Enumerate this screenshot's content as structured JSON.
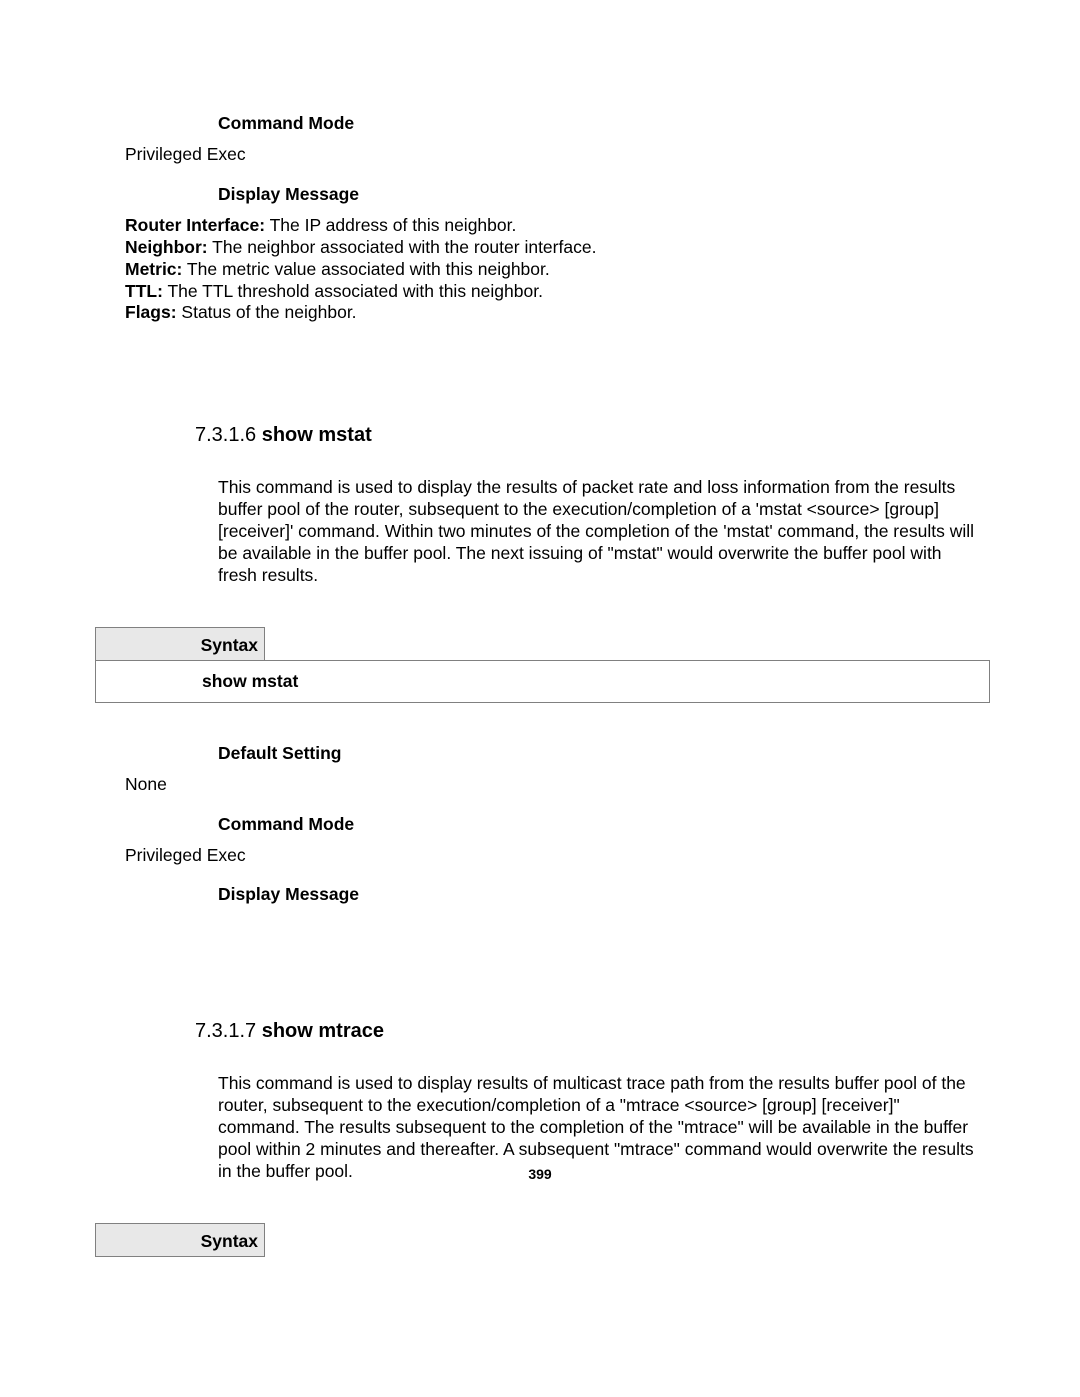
{
  "top": {
    "cmd_mode_label": "Command Mode",
    "cmd_mode_value": "Privileged Exec",
    "display_label": "Display Message",
    "fields": [
      {
        "name": "Router Interface:",
        "desc": " The IP address of this neighbor."
      },
      {
        "name": "Neighbor:",
        "desc": " The neighbor associated with the router interface."
      },
      {
        "name": "Metric:",
        "desc": " The metric value associated with this neighbor."
      },
      {
        "name": "TTL:",
        "desc": " The TTL threshold associated with this neighbor."
      },
      {
        "name": "Flags:",
        "desc": " Status of the neighbor."
      }
    ]
  },
  "s1": {
    "number": "7.3.1.6 ",
    "title": "show mstat",
    "desc": "This command is used to display the results of packet rate and loss information from the results buffer pool of the router, subsequent to the execution/completion of a 'mstat <source> [group] [receiver]' command. Within two minutes of the completion of the 'mstat' command, the results will be available in the buffer pool. The next issuing of \"mstat\" would overwrite the buffer pool with fresh results.",
    "syntax_label": "Syntax",
    "syntax_cmd": "show mstat",
    "default_label": "Default Setting",
    "default_value": "None",
    "cmd_mode_label": "Command Mode",
    "cmd_mode_value": "Privileged Exec",
    "display_label": "Display Message"
  },
  "s2": {
    "number": "7.3.1.7 ",
    "title": "show mtrace",
    "desc": "This command is used to display results of multicast trace path from the results buffer pool of the router, subsequent to the execution/completion of a \"mtrace <source> [group] [receiver]\" command. The results subsequent to the completion of the \"mtrace\" will be available in the buffer pool within 2 minutes and thereafter. A subsequent \"mtrace\" command would overwrite the results in the buffer pool.",
    "syntax_label": "Syntax"
  },
  "page_number": "399"
}
